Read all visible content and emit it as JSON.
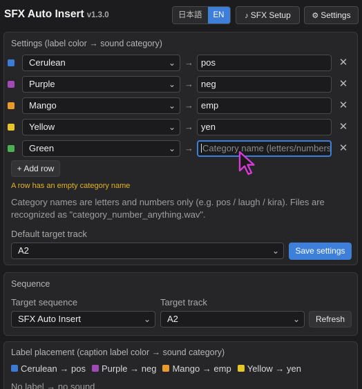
{
  "header": {
    "app_title": "SFX Auto Insert",
    "version": "v1.3.0",
    "lang_ja": "日本語",
    "lang_en": "EN",
    "sfx_setup_icon": "♪",
    "sfx_setup_label": "SFX Setup",
    "settings_icon": "⚙",
    "settings_label": "Settings"
  },
  "settings_panel": {
    "title": "Settings (label color → sound category)",
    "arrow": "→",
    "remove_glyph": "✕",
    "rows": [
      {
        "color_name": "Cerulean",
        "color": "#3b7bd4",
        "category": "pos"
      },
      {
        "color_name": "Purple",
        "color": "#a04ab5",
        "category": "neg"
      },
      {
        "color_name": "Mango",
        "color": "#e89a2c",
        "category": "emp"
      },
      {
        "color_name": "Yellow",
        "color": "#e6c52a",
        "category": "yen"
      },
      {
        "color_name": "Green",
        "color": "#4caf50",
        "category": "",
        "placeholder": "Category name (letters/numbers)"
      }
    ],
    "add_row_label": "+ Add row",
    "warning": "A row has an empty category name",
    "help_text": "Category names are letters and numbers only (e.g. pos / laugh / kira). Files are recognized as \"category_number_anything.wav\".",
    "default_track_label": "Default target track",
    "default_track_value": "A2",
    "save_label": "Save settings"
  },
  "sequence_panel": {
    "title": "Sequence",
    "target_sequence_label": "Target sequence",
    "target_sequence_value": "SFX Auto Insert",
    "target_track_label": "Target track",
    "target_track_value": "A2",
    "refresh_label": "Refresh"
  },
  "placement_panel": {
    "title": "Label placement (caption label color → sound category)",
    "legend": [
      {
        "text": "Cerulean → pos",
        "color": "#3b7bd4"
      },
      {
        "text": "Purple → neg",
        "color": "#a04ab5"
      },
      {
        "text": "Mango → emp",
        "color": "#e89a2c"
      },
      {
        "text": "Yellow → yen",
        "color": "#e6c52a"
      }
    ],
    "no_label_text": "No label → no sound"
  },
  "colors": {
    "accent": "#3d7fd9",
    "warning": "#e3b324",
    "cursor": "#d63bd6"
  }
}
